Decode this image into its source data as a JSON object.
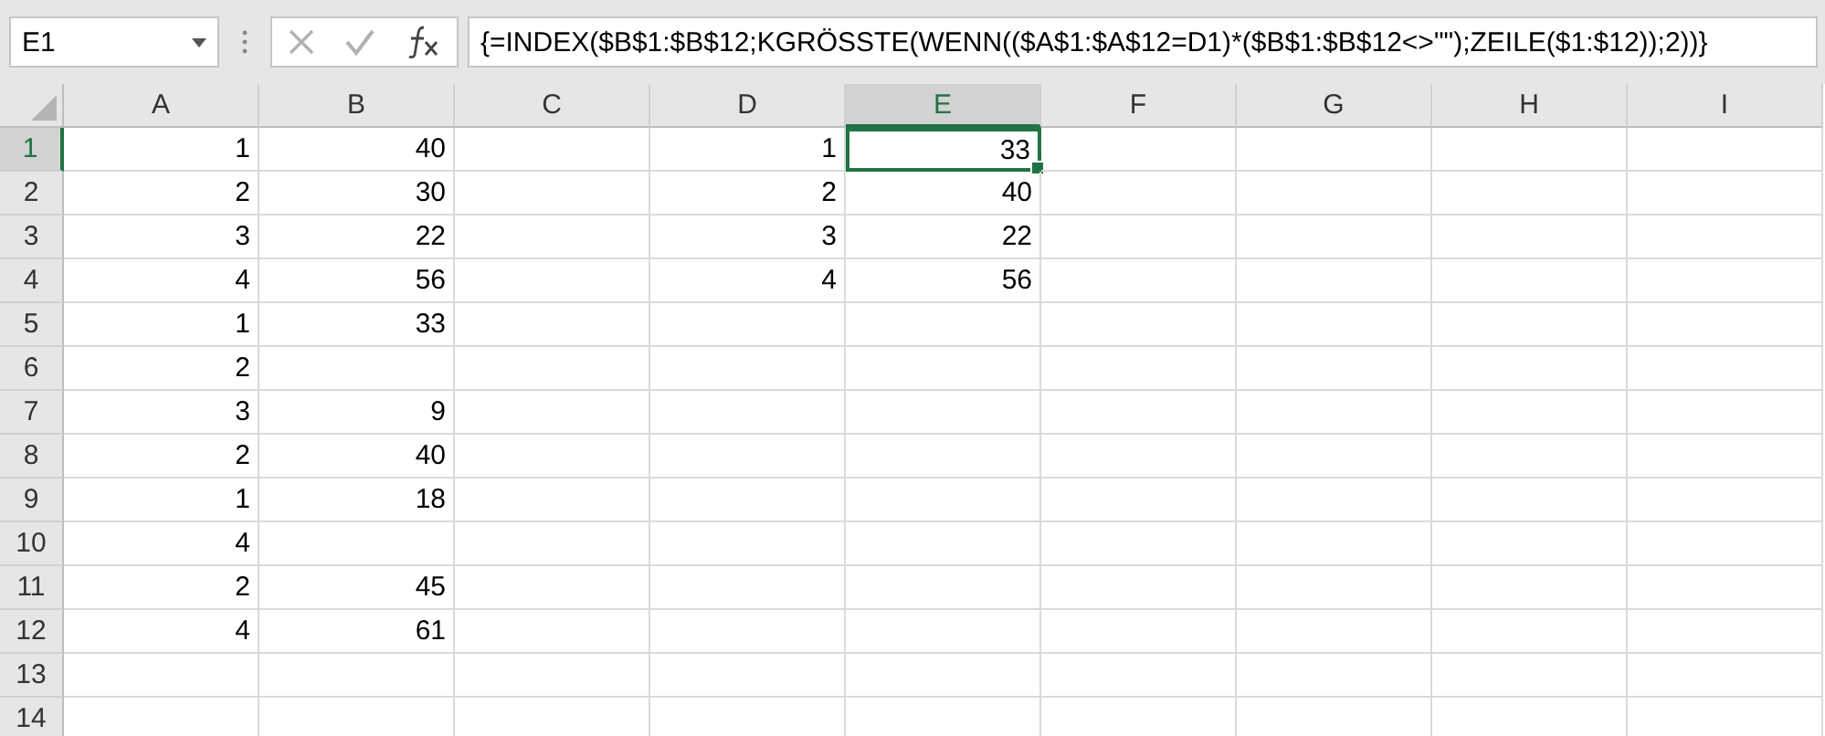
{
  "name_box": "E1",
  "formula": "{=INDEX($B$1:$B$12;KGRÖSSTE(WENN(($A$1:$A$12=D1)*($B$1:$B$12<>\"\");ZEILE($1:$12));2))}",
  "columns": [
    {
      "label": "A",
      "selected": false
    },
    {
      "label": "B",
      "selected": false
    },
    {
      "label": "C",
      "selected": false
    },
    {
      "label": "D",
      "selected": false
    },
    {
      "label": "E",
      "selected": true
    },
    {
      "label": "F",
      "selected": false
    },
    {
      "label": "G",
      "selected": false
    },
    {
      "label": "H",
      "selected": false
    },
    {
      "label": "I",
      "selected": false
    }
  ],
  "rows": [
    {
      "label": "1",
      "selected": true,
      "cells": {
        "A": {
          "value": "1",
          "selected": false
        },
        "B": {
          "value": "40",
          "selected": false
        },
        "D": {
          "value": "1",
          "selected": false
        },
        "E": {
          "value": "33",
          "selected": true
        }
      }
    },
    {
      "label": "2",
      "selected": false,
      "cells": {
        "A": {
          "value": "2",
          "selected": false
        },
        "B": {
          "value": "30",
          "selected": false
        },
        "D": {
          "value": "2",
          "selected": false
        },
        "E": {
          "value": "40",
          "selected": false
        }
      }
    },
    {
      "label": "3",
      "selected": false,
      "cells": {
        "A": {
          "value": "3",
          "selected": false
        },
        "B": {
          "value": "22",
          "selected": false
        },
        "D": {
          "value": "3",
          "selected": false
        },
        "E": {
          "value": "22",
          "selected": false
        }
      }
    },
    {
      "label": "4",
      "selected": false,
      "cells": {
        "A": {
          "value": "4",
          "selected": false
        },
        "B": {
          "value": "56",
          "selected": false
        },
        "D": {
          "value": "4",
          "selected": false
        },
        "E": {
          "value": "56",
          "selected": false
        }
      }
    },
    {
      "label": "5",
      "selected": false,
      "cells": {
        "A": {
          "value": "1",
          "selected": false
        },
        "B": {
          "value": "33",
          "selected": false
        }
      }
    },
    {
      "label": "6",
      "selected": false,
      "cells": {
        "A": {
          "value": "2",
          "selected": false
        }
      }
    },
    {
      "label": "7",
      "selected": false,
      "cells": {
        "A": {
          "value": "3",
          "selected": false
        },
        "B": {
          "value": "9",
          "selected": false
        }
      }
    },
    {
      "label": "8",
      "selected": false,
      "cells": {
        "A": {
          "value": "2",
          "selected": false
        },
        "B": {
          "value": "40",
          "selected": false
        }
      }
    },
    {
      "label": "9",
      "selected": false,
      "cells": {
        "A": {
          "value": "1",
          "selected": false
        },
        "B": {
          "value": "18",
          "selected": false
        }
      }
    },
    {
      "label": "10",
      "selected": false,
      "cells": {
        "A": {
          "value": "4",
          "selected": false
        }
      }
    },
    {
      "label": "11",
      "selected": false,
      "cells": {
        "A": {
          "value": "2",
          "selected": false
        },
        "B": {
          "value": "45",
          "selected": false
        }
      }
    },
    {
      "label": "12",
      "selected": false,
      "cells": {
        "A": {
          "value": "4",
          "selected": false
        },
        "B": {
          "value": "61",
          "selected": false
        }
      }
    },
    {
      "label": "13",
      "selected": false
    },
    {
      "label": "14",
      "selected": false
    }
  ]
}
